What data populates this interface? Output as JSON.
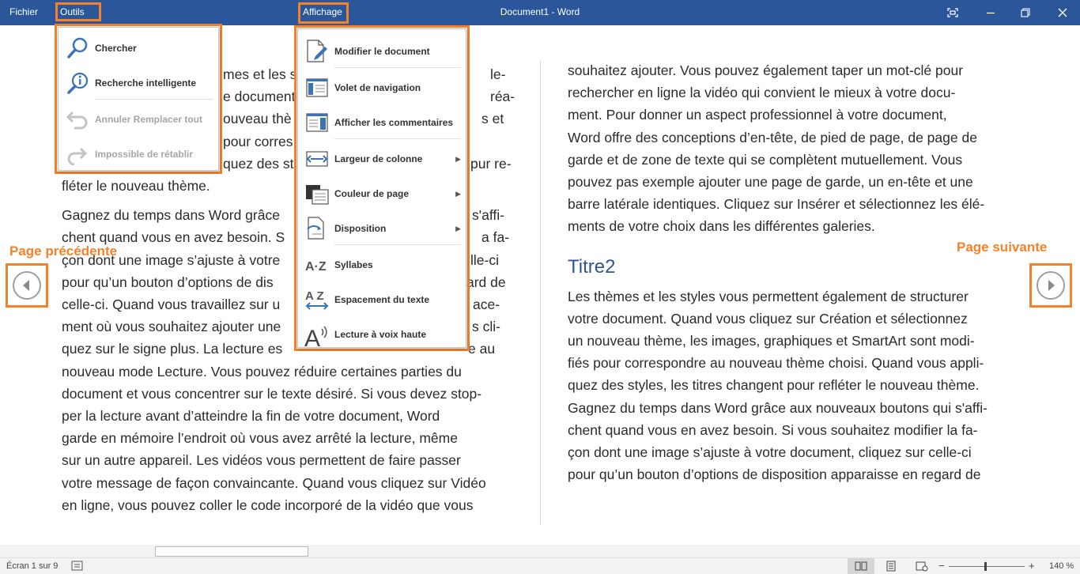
{
  "titlebar": {
    "menu_fichier": "Fichier",
    "menu_outils": "Outils",
    "menu_affichage": "Affichage",
    "title": "Document1 - Word"
  },
  "colors": {
    "accent": "#2b579a",
    "highlight": "#f4822a",
    "heading": "#2f5597"
  },
  "document": {
    "left_lines": [
      "mes et les s",
      "e document",
      "ouveau thè",
      "pour corres",
      "quez des st",
      "fléter le nouveau thème."
    ],
    "left_lines_right_fragments": [
      "le-",
      "réa-",
      "s et",
      "",
      "pur re-"
    ],
    "left_para2": [
      "Gagnez du temps dans Word grâce",
      "chent quand vous en avez besoin. S",
      "çon dont une image s’ajuste à votre",
      "pour qu’un bouton d’options de dis",
      "celle-ci. Quand vous travaillez sur u",
      "ment où vous souhaitez ajouter une",
      "quez sur le signe plus. La lecture es",
      "nouveau mode Lecture. Vous pouvez réduire certaines parties du",
      "document et vous concentrer sur le texte désiré. Si vous devez stop-",
      "per la lecture avant d’atteindre la fin de votre document, Word",
      "garde en mémoire l’endroit où vous avez arrêté la lecture, même",
      "sur un autre appareil. Les vidéos vous permettent de faire passer",
      "votre message de façon convaincante. Quand vous cliquez sur Vidéo",
      "en ligne, vous pouvez coller le code incorporé de la vidéo que vous"
    ],
    "left_para2_right_fragments": [
      "s'affi-",
      "a fa-",
      "lle-ci",
      "ard de",
      "ace-",
      "s cli-",
      "e au"
    ],
    "right_para1": [
      "souhaitez ajouter. Vous pouvez également taper un mot-clé pour",
      "rechercher en ligne la vidéo qui convient le mieux à votre docu-",
      "ment. Pour donner un aspect professionnel à votre document,",
      "Word offre des conceptions d’en-tête, de pied de page, de page de",
      "garde et de zone de texte qui se complètent mutuellement. Vous",
      "pouvez pas exemple ajouter une page de garde, un en-tête et une",
      "barre latérale identiques. Cliquez sur Insérer et sélectionnez les élé-",
      "ments de votre choix dans les différentes galeries."
    ],
    "heading": "Titre2",
    "right_para2": [
      "Les thèmes et les styles vous permettent également de structurer",
      "votre document. Quand vous cliquez sur Création et sélectionnez",
      "un nouveau thème, les images, graphiques et SmartArt sont modi-",
      "fiés pour correspondre au nouveau thème choisi. Quand vous appli-",
      "quez des styles, les titres changent pour refléter le nouveau thème.",
      "Gagnez du temps dans Word grâce aux nouveaux boutons qui s'affi-",
      "chent quand vous en avez besoin. Si vous souhaitez modifier la fa-",
      "çon dont une image s’ajuste à votre document, cliquez sur celle-ci",
      "pour qu’un bouton d’options de disposition apparaisse en regard de"
    ]
  },
  "nav": {
    "prev_label": "Page précédente",
    "next_label": "Page suivante"
  },
  "outils_menu": {
    "items": [
      {
        "label": "Chercher",
        "icon": "search-icon",
        "enabled": true
      },
      {
        "label": "Recherche intelligente",
        "icon": "smart-lookup-icon",
        "enabled": true
      },
      {
        "label": "Annuler Remplacer tout",
        "icon": "undo-icon",
        "enabled": false
      },
      {
        "label": "Impossible de rétablir",
        "icon": "redo-icon",
        "enabled": false
      }
    ]
  },
  "affichage_menu": {
    "items": [
      {
        "label": "Modifier le document",
        "icon": "edit-document-icon",
        "submenu": false
      },
      {
        "label": "Volet de navigation",
        "icon": "navigation-pane-icon",
        "submenu": false
      },
      {
        "label": "Afficher les commentaires",
        "icon": "comments-icon",
        "submenu": false
      },
      {
        "label": "Largeur de colonne",
        "icon": "column-width-icon",
        "submenu": true
      },
      {
        "label": "Couleur de page",
        "icon": "page-color-icon",
        "submenu": true
      },
      {
        "label": "Disposition",
        "icon": "layout-icon",
        "submenu": true
      },
      {
        "label": "Syllabes",
        "icon": "syllables-icon",
        "submenu": false
      },
      {
        "label": "Espacement du texte",
        "icon": "text-spacing-icon",
        "submenu": false
      },
      {
        "label": "Lecture à voix haute",
        "icon": "read-aloud-icon",
        "submenu": false
      }
    ]
  },
  "statusbar": {
    "page_info": "Écran 1 sur 9",
    "zoom": "140 %",
    "zoom_level_fraction": 0.47
  }
}
